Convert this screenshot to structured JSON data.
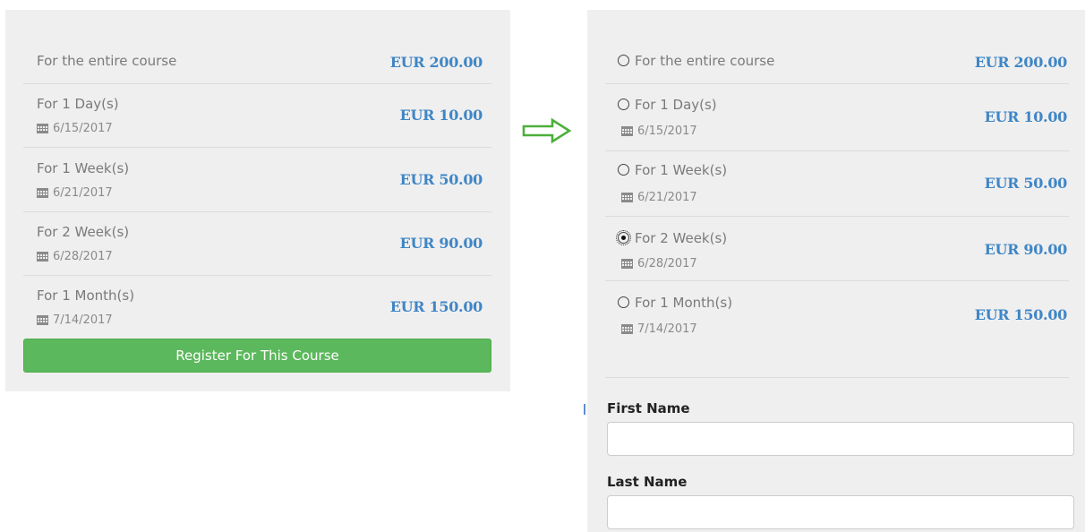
{
  "left": {
    "options": [
      {
        "label": "For the entire course",
        "date": "",
        "price": "EUR 200.00"
      },
      {
        "label": "For 1 Day(s)",
        "date": "6/15/2017",
        "price": "EUR 10.00"
      },
      {
        "label": "For 1 Week(s)",
        "date": "6/21/2017",
        "price": "EUR 50.00"
      },
      {
        "label": "For 2 Week(s)",
        "date": "6/28/2017",
        "price": "EUR 90.00"
      },
      {
        "label": "For 1 Month(s)",
        "date": "7/14/2017",
        "price": "EUR 150.00"
      }
    ],
    "register_label": "Register For This Course"
  },
  "right": {
    "options": [
      {
        "label": "For the entire course",
        "date": "",
        "price": "EUR 200.00",
        "selected": false
      },
      {
        "label": "For 1 Day(s)",
        "date": "6/15/2017",
        "price": "EUR 10.00",
        "selected": false
      },
      {
        "label": "For 1 Week(s)",
        "date": "6/21/2017",
        "price": "EUR 50.00",
        "selected": false
      },
      {
        "label": "For 2 Week(s)",
        "date": "6/28/2017",
        "price": "EUR 90.00",
        "selected": true
      },
      {
        "label": "For 1 Month(s)",
        "date": "7/14/2017",
        "price": "EUR 150.00",
        "selected": false
      }
    ],
    "form": {
      "first_name_label": "First Name",
      "first_name_value": "",
      "last_name_label": "Last Name",
      "last_name_value": ""
    }
  },
  "icons": {
    "calendar": "calendar-icon",
    "arrow": "arrow-right-icon"
  },
  "colors": {
    "price": "#3f86c6",
    "button": "#5cb85c",
    "arrow": "#4caf3a",
    "panel": "#efefef"
  }
}
